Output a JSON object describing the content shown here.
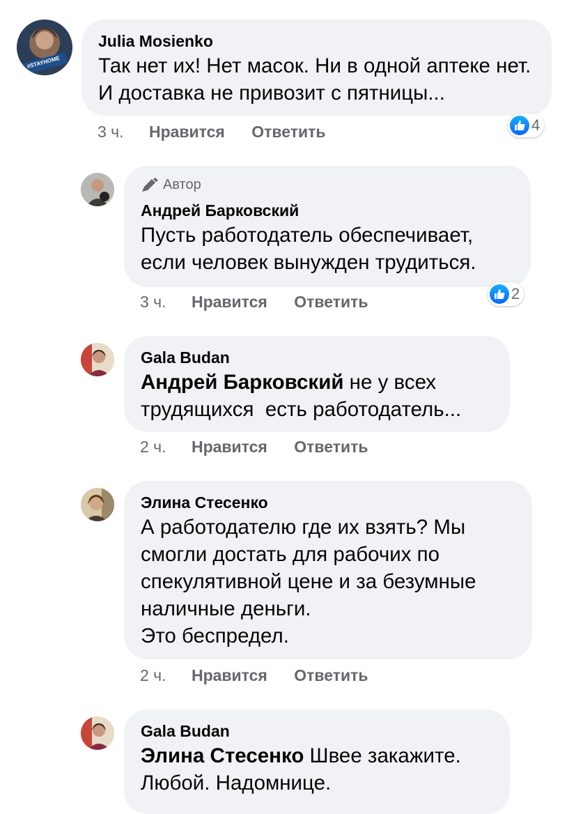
{
  "comments": [
    {
      "author": "Julia Mosienko",
      "avatar_badge": "#STAYHOME",
      "text": "Так нет их! Нет масок. Ни в одной аптеке нет. И доставка не привозит с пятницы...",
      "time": "3 ч.",
      "like_label": "Нравится",
      "reply_label": "Ответить",
      "reactions": "4"
    },
    {
      "author_badge": "Автор",
      "author": "Андрей Барковский",
      "text": "Пусть работодатель обеспечивает, если человек вынужден трудиться.",
      "time": "3 ч.",
      "like_label": "Нравится",
      "reply_label": "Ответить",
      "reactions": "2"
    },
    {
      "author": "Gala Budan",
      "mention": "Андрей Барковский",
      "text": " не у всех трудящихся  есть работодатель...",
      "time": "2 ч.",
      "like_label": "Нравится",
      "reply_label": "Ответить"
    },
    {
      "author": "Элина Стесенко",
      "text_lines": [
        "А работодателю где их взять? Мы",
        "смогли достать для рабочих по",
        "спекулятивной цене и за безумные",
        "наличные деньги.",
        "Это беспредел."
      ],
      "time": "2 ч.",
      "like_label": "Нравится",
      "reply_label": "Ответить"
    },
    {
      "author": "Gala Budan",
      "mention": "Элина Стесенко",
      "text": " Швее закажите. Любой. Надомнице."
    }
  ],
  "colors": {
    "bubble": "#f0f2f5",
    "meta": "#65676b",
    "like_blue": "#0866ff"
  },
  "icons": [
    "thumbs-up-icon",
    "pencil-icon"
  ]
}
